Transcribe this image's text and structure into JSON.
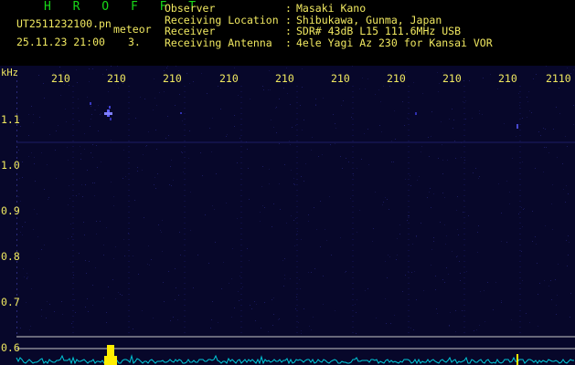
{
  "header": {
    "title": "H R O F F T",
    "filename": "UT2511232100.pn",
    "meteor_label": "meteor",
    "datetime": "25.11.23 21:00",
    "meteor_count": "3."
  },
  "station": [
    {
      "key": "Observer",
      "value": "Masaki Kano"
    },
    {
      "key": "Receiving Location",
      "value": "Shibukawa, Gunma, Japan"
    },
    {
      "key": "Receiver",
      "value": "SDR# 43dB L15 111.6MHz USB"
    },
    {
      "key": "Receiving Antenna",
      "value": "4ele Yagi Az 230 for Kansai VOR"
    }
  ],
  "spectrogram": {
    "freq_unit": "kHz",
    "time_ticks": [
      "210",
      "210",
      "210",
      "210",
      "210",
      "210",
      "210",
      "210",
      "210",
      "2110"
    ],
    "freq_ticks": [
      "1.1",
      "1.0",
      "0.9",
      "0.8",
      "0.7",
      "0.6"
    ],
    "colors": {
      "background": "#07072a",
      "text": "#f0e860",
      "title": "#18d818",
      "signal": "#00c8d8",
      "meteor": "#ffee00"
    }
  }
}
